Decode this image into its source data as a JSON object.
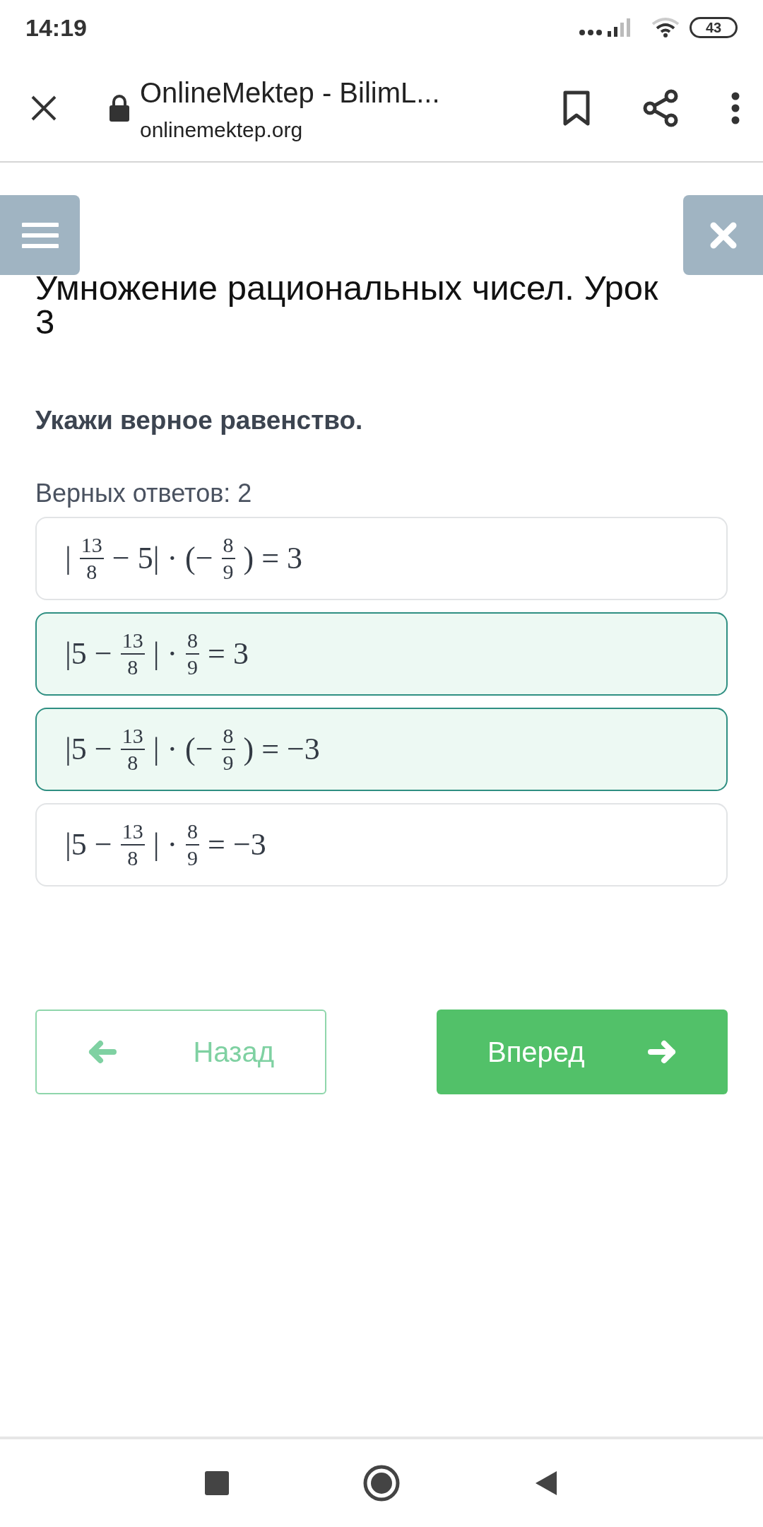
{
  "status_bar": {
    "time": "14:19",
    "battery": "43"
  },
  "browser_bar": {
    "title": "OnlineMektep - BilimL...",
    "url": "onlinemektep.org"
  },
  "lesson_title": "Умножение рациональных чисел. Урок 3",
  "question": "Укажи верное равенство.",
  "answer_count": "Верных ответов: 2",
  "options": [
    {
      "selected": false,
      "parts": [
        {
          "kind": "text",
          "text": "|"
        },
        {
          "kind": "frac",
          "num": "13",
          "den": "8"
        },
        {
          "kind": "text",
          "text": "− 5| · (−"
        },
        {
          "kind": "frac",
          "num": "8",
          "den": "9"
        },
        {
          "kind": "text",
          "text": ") = 3"
        }
      ]
    },
    {
      "selected": true,
      "parts": [
        {
          "kind": "text",
          "text": "|5 −"
        },
        {
          "kind": "frac",
          "num": "13",
          "den": "8"
        },
        {
          "kind": "text",
          "text": "| ·"
        },
        {
          "kind": "frac",
          "num": "8",
          "den": "9"
        },
        {
          "kind": "text",
          "text": "= 3"
        }
      ]
    },
    {
      "selected": true,
      "parts": [
        {
          "kind": "text",
          "text": "|5 −"
        },
        {
          "kind": "frac",
          "num": "13",
          "den": "8"
        },
        {
          "kind": "text",
          "text": "| · (−"
        },
        {
          "kind": "frac",
          "num": "8",
          "den": "9"
        },
        {
          "kind": "text",
          "text": ") = −3"
        }
      ]
    },
    {
      "selected": false,
      "parts": [
        {
          "kind": "text",
          "text": "|5 −"
        },
        {
          "kind": "frac",
          "num": "13",
          "den": "8"
        },
        {
          "kind": "text",
          "text": "| ·"
        },
        {
          "kind": "frac",
          "num": "8",
          "den": "9"
        },
        {
          "kind": "text",
          "text": "= −3"
        }
      ]
    }
  ],
  "nav_buttons": [
    {
      "label": "Назад",
      "kind": "back",
      "disabled": true
    },
    {
      "label": "Вперед",
      "kind": "forward",
      "disabled": false
    }
  ]
}
